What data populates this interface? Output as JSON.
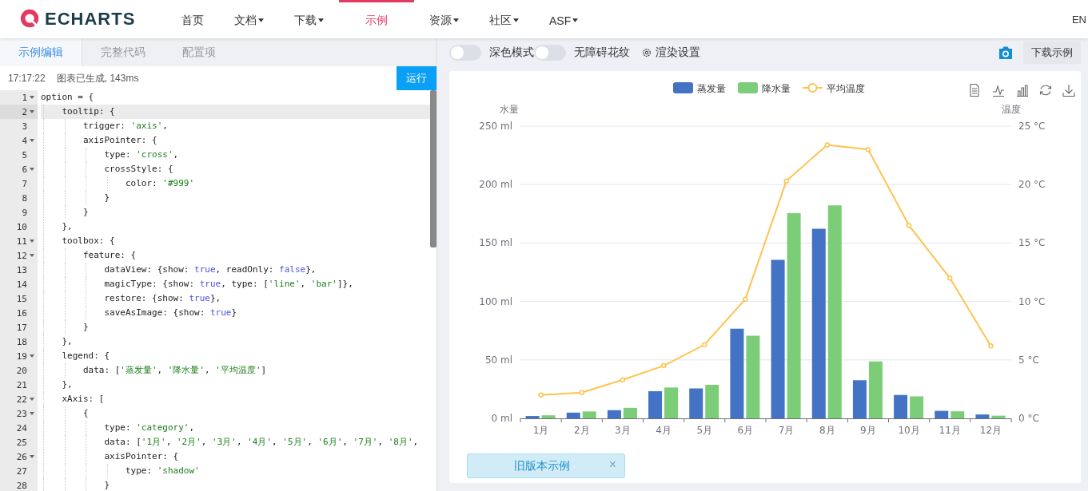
{
  "header": {
    "logo": "ECHARTS",
    "nav": [
      {
        "label": "首页",
        "dropdown": false,
        "selected": false
      },
      {
        "label": "文档",
        "dropdown": true,
        "selected": false
      },
      {
        "label": "下载",
        "dropdown": true,
        "selected": false
      },
      {
        "label": "示例",
        "dropdown": false,
        "selected": true
      },
      {
        "label": "资源",
        "dropdown": true,
        "selected": false
      },
      {
        "label": "社区",
        "dropdown": true,
        "selected": false
      },
      {
        "label": "ASF",
        "dropdown": true,
        "selected": false
      }
    ],
    "language": "EN"
  },
  "editor": {
    "tabs": [
      {
        "label": "示例编辑",
        "selected": true
      },
      {
        "label": "完整代码",
        "selected": false
      },
      {
        "label": "配置项",
        "selected": false
      }
    ],
    "status": {
      "time": "17:17:22",
      "message": "图表已生成, 143ms"
    },
    "run_button": "运行",
    "lines": [
      {
        "number": "1",
        "foldable": true,
        "active": false,
        "tokens": [
          {
            "text": "option = {",
            "kind": "plain"
          }
        ]
      },
      {
        "number": "2",
        "foldable": true,
        "active": true,
        "tokens": [
          {
            "text": "    tooltip: {",
            "kind": "plain"
          }
        ]
      },
      {
        "number": "3",
        "foldable": false,
        "active": false,
        "tokens": [
          {
            "text": "        trigger: ",
            "kind": "plain"
          },
          {
            "text": "'axis'",
            "kind": "string"
          },
          {
            "text": ",",
            "kind": "plain"
          }
        ]
      },
      {
        "number": "4",
        "foldable": true,
        "active": false,
        "tokens": [
          {
            "text": "        axisPointer: {",
            "kind": "plain"
          }
        ]
      },
      {
        "number": "5",
        "foldable": false,
        "active": false,
        "tokens": [
          {
            "text": "            type: ",
            "kind": "plain"
          },
          {
            "text": "'cross'",
            "kind": "string"
          },
          {
            "text": ",",
            "kind": "plain"
          }
        ]
      },
      {
        "number": "6",
        "foldable": true,
        "active": false,
        "tokens": [
          {
            "text": "            crossStyle: {",
            "kind": "plain"
          }
        ]
      },
      {
        "number": "7",
        "foldable": false,
        "active": false,
        "tokens": [
          {
            "text": "                color: ",
            "kind": "plain"
          },
          {
            "text": "'#999'",
            "kind": "string"
          }
        ]
      },
      {
        "number": "8",
        "foldable": false,
        "active": false,
        "tokens": [
          {
            "text": "            }",
            "kind": "plain"
          }
        ]
      },
      {
        "number": "9",
        "foldable": false,
        "active": false,
        "tokens": [
          {
            "text": "        }",
            "kind": "plain"
          }
        ]
      },
      {
        "number": "10",
        "foldable": false,
        "active": false,
        "tokens": [
          {
            "text": "    },",
            "kind": "plain"
          }
        ]
      },
      {
        "number": "11",
        "foldable": true,
        "active": false,
        "tokens": [
          {
            "text": "    toolbox: {",
            "kind": "plain"
          }
        ]
      },
      {
        "number": "12",
        "foldable": true,
        "active": false,
        "tokens": [
          {
            "text": "        feature: {",
            "kind": "plain"
          }
        ]
      },
      {
        "number": "13",
        "foldable": false,
        "active": false,
        "tokens": [
          {
            "text": "            dataView: {show: ",
            "kind": "plain"
          },
          {
            "text": "true",
            "kind": "keyword"
          },
          {
            "text": ", readOnly: ",
            "kind": "plain"
          },
          {
            "text": "false",
            "kind": "keyword"
          },
          {
            "text": "},",
            "kind": "plain"
          }
        ]
      },
      {
        "number": "14",
        "foldable": false,
        "active": false,
        "tokens": [
          {
            "text": "            magicType: {show: ",
            "kind": "plain"
          },
          {
            "text": "true",
            "kind": "keyword"
          },
          {
            "text": ", type: [",
            "kind": "plain"
          },
          {
            "text": "'line'",
            "kind": "string"
          },
          {
            "text": ", ",
            "kind": "plain"
          },
          {
            "text": "'bar'",
            "kind": "string"
          },
          {
            "text": "]},",
            "kind": "plain"
          }
        ]
      },
      {
        "number": "15",
        "foldable": false,
        "active": false,
        "tokens": [
          {
            "text": "            restore: {show: ",
            "kind": "plain"
          },
          {
            "text": "true",
            "kind": "keyword"
          },
          {
            "text": "},",
            "kind": "plain"
          }
        ]
      },
      {
        "number": "16",
        "foldable": false,
        "active": false,
        "tokens": [
          {
            "text": "            saveAsImage: {show: ",
            "kind": "plain"
          },
          {
            "text": "true",
            "kind": "keyword"
          },
          {
            "text": "}",
            "kind": "plain"
          }
        ]
      },
      {
        "number": "17",
        "foldable": false,
        "active": false,
        "tokens": [
          {
            "text": "        }",
            "kind": "plain"
          }
        ]
      },
      {
        "number": "18",
        "foldable": false,
        "active": false,
        "tokens": [
          {
            "text": "    },",
            "kind": "plain"
          }
        ]
      },
      {
        "number": "19",
        "foldable": true,
        "active": false,
        "tokens": [
          {
            "text": "    legend: {",
            "kind": "plain"
          }
        ]
      },
      {
        "number": "20",
        "foldable": false,
        "active": false,
        "tokens": [
          {
            "text": "        data: [",
            "kind": "plain"
          },
          {
            "text": "'蒸发量'",
            "kind": "string"
          },
          {
            "text": ", ",
            "kind": "plain"
          },
          {
            "text": "'降水量'",
            "kind": "string"
          },
          {
            "text": ", ",
            "kind": "plain"
          },
          {
            "text": "'平均温度'",
            "kind": "string"
          },
          {
            "text": "]",
            "kind": "plain"
          }
        ]
      },
      {
        "number": "21",
        "foldable": false,
        "active": false,
        "tokens": [
          {
            "text": "    },",
            "kind": "plain"
          }
        ]
      },
      {
        "number": "22",
        "foldable": true,
        "active": false,
        "tokens": [
          {
            "text": "    xAxis: [",
            "kind": "plain"
          }
        ]
      },
      {
        "number": "23",
        "foldable": true,
        "active": false,
        "tokens": [
          {
            "text": "        {",
            "kind": "plain"
          }
        ]
      },
      {
        "number": "24",
        "foldable": false,
        "active": false,
        "tokens": [
          {
            "text": "            type: ",
            "kind": "plain"
          },
          {
            "text": "'category'",
            "kind": "string"
          },
          {
            "text": ",",
            "kind": "plain"
          }
        ]
      },
      {
        "number": "25",
        "foldable": false,
        "active": false,
        "tokens": [
          {
            "text": "            data: [",
            "kind": "plain"
          },
          {
            "text": "'1月'",
            "kind": "string"
          },
          {
            "text": ", ",
            "kind": "plain"
          },
          {
            "text": "'2月'",
            "kind": "string"
          },
          {
            "text": ", ",
            "kind": "plain"
          },
          {
            "text": "'3月'",
            "kind": "string"
          },
          {
            "text": ", ",
            "kind": "plain"
          },
          {
            "text": "'4月'",
            "kind": "string"
          },
          {
            "text": ", ",
            "kind": "plain"
          },
          {
            "text": "'5月'",
            "kind": "string"
          },
          {
            "text": ", ",
            "kind": "plain"
          },
          {
            "text": "'6月'",
            "kind": "string"
          },
          {
            "text": ", ",
            "kind": "plain"
          },
          {
            "text": "'7月'",
            "kind": "string"
          },
          {
            "text": ", ",
            "kind": "plain"
          },
          {
            "text": "'8月'",
            "kind": "string"
          },
          {
            "text": ",",
            "kind": "plain"
          }
        ]
      },
      {
        "number": "26",
        "foldable": true,
        "active": false,
        "tokens": [
          {
            "text": "            axisPointer: {",
            "kind": "plain"
          }
        ]
      },
      {
        "number": "27",
        "foldable": false,
        "active": false,
        "tokens": [
          {
            "text": "                type: ",
            "kind": "plain"
          },
          {
            "text": "'shadow'",
            "kind": "string"
          }
        ]
      },
      {
        "number": "28",
        "foldable": false,
        "active": false,
        "tokens": [
          {
            "text": "            }",
            "kind": "plain"
          }
        ]
      }
    ]
  },
  "preview": {
    "toggles": [
      {
        "label": "深色模式",
        "on": false
      },
      {
        "label": "无障碍花纹",
        "on": false
      }
    ],
    "render_settings": "渲染设置",
    "download_button": "下载示例",
    "chart": {
      "chart_data": {
        "type": "bar",
        "ylabel": "水量",
        "grid": true,
        "legend": true,
        "categories": [
          "1月",
          "2月",
          "3月",
          "4月",
          "5月",
          "6月",
          "7月",
          "8月",
          "9月",
          "10月",
          "11月",
          "12月"
        ],
        "series": [
          {
            "name": "蒸发量",
            "type": "bar",
            "color": "#4472c4",
            "values": [
              2.0,
              4.9,
              7.0,
              23.2,
              25.6,
              76.7,
              135.6,
              162.2,
              32.6,
              20.0,
              6.4,
              3.3
            ]
          },
          {
            "name": "降水量",
            "type": "bar",
            "color": "#7ccd78",
            "values": [
              2.6,
              5.9,
              9.0,
              26.4,
              28.7,
              70.7,
              175.6,
              182.2,
              48.7,
              18.8,
              6.0,
              2.3
            ]
          }
        ],
        "ylim": [
          0,
          250
        ],
        "yticks": [
          {
            "value": 0,
            "label": "0 ml"
          },
          {
            "value": 50,
            "label": "50 ml"
          },
          {
            "value": 100,
            "label": "100 ml"
          },
          {
            "value": 150,
            "label": "150 ml"
          },
          {
            "value": 200,
            "label": "200 ml"
          },
          {
            "value": 250,
            "label": "250 ml"
          }
        ]
      }
    },
    "temperature_chart": {
      "chart_data": {
        "type": "line",
        "ylabel": "温度",
        "series": [
          {
            "name": "平均温度",
            "color": "#fec34f",
            "marker": true,
            "values": [
              2.0,
              2.2,
              3.3,
              4.5,
              6.3,
              10.2,
              20.3,
              23.4,
              23.0,
              16.5,
              12.0,
              6.2
            ]
          }
        ],
        "ylim": [
          0,
          25
        ],
        "yticks": [
          {
            "value": 0,
            "label": "0 °C"
          },
          {
            "value": 5,
            "label": "5 °C"
          },
          {
            "value": 10,
            "label": "10 °C"
          },
          {
            "value": 15,
            "label": "15 °C"
          },
          {
            "value": 20,
            "label": "20 °C"
          },
          {
            "value": 25,
            "label": "25 °C"
          }
        ]
      }
    },
    "old_version_banner": "旧版本示例",
    "banner_close": "×"
  }
}
